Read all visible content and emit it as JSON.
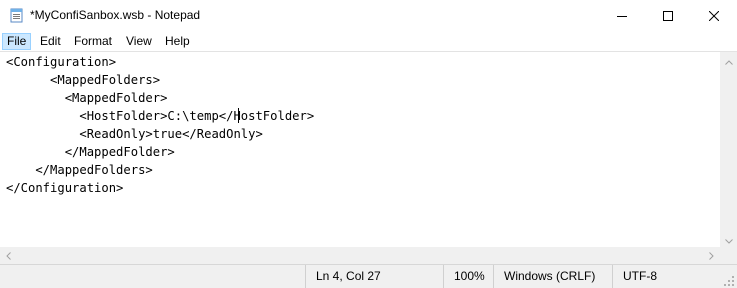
{
  "window": {
    "title": "*MyConfiSanbox.wsb - Notepad",
    "app_icon": "notepad-icon",
    "controls": [
      "minimize-icon",
      "maximize-icon",
      "close-icon"
    ]
  },
  "menu": {
    "items": [
      {
        "label": "File",
        "active": true
      },
      {
        "label": "Edit"
      },
      {
        "label": "Format"
      },
      {
        "label": "View"
      },
      {
        "label": "Help"
      }
    ]
  },
  "editor": {
    "lines": [
      "<Configuration>",
      "      <MappedFolders>",
      "        <MappedFolder>",
      "          <HostFolder>C:\\temp</HostFolder>",
      "          <ReadOnly>true</ReadOnly>",
      "        </MappedFolder>",
      "    </MappedFolders>",
      "</Configuration>"
    ],
    "caret": {
      "line": 4,
      "col": 27
    }
  },
  "status": {
    "position": "Ln 4, Col 27",
    "zoom": "100%",
    "line_ending": "Windows (CRLF)",
    "encoding": "UTF-8"
  },
  "colors": {
    "menu_active_bg": "#cce8ff",
    "menu_active_border": "#99d1ff",
    "status_bg": "#f0f0f0"
  }
}
